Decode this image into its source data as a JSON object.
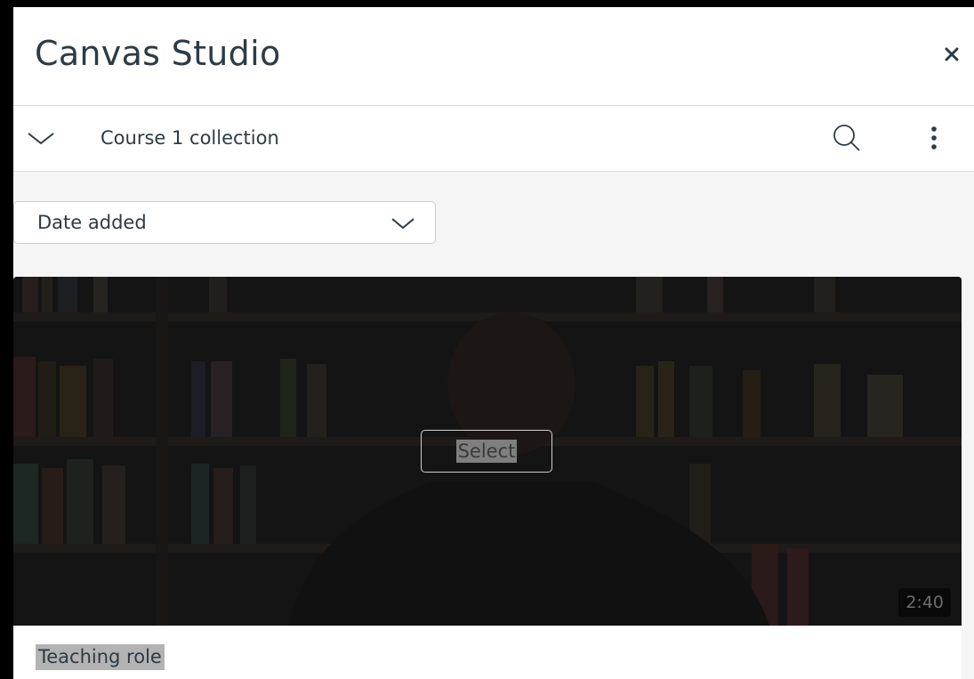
{
  "header": {
    "title": "Canvas Studio",
    "close_icon": "close-icon"
  },
  "collection_bar": {
    "name": "Course 1 collection",
    "collapse_icon": "chevron-down-icon",
    "search_icon": "search-icon",
    "more_icon": "more-vertical-icon"
  },
  "sort": {
    "selected": "Date added",
    "chevron_icon": "chevron-down-icon"
  },
  "videos": [
    {
      "title": "Teaching role",
      "duration": "2:40",
      "select_label": "Select"
    }
  ],
  "colors": {
    "text": "#2d3b45",
    "panel_bg": "#f5f5f5",
    "border": "#c7cdd1",
    "overlay": "#141414"
  }
}
